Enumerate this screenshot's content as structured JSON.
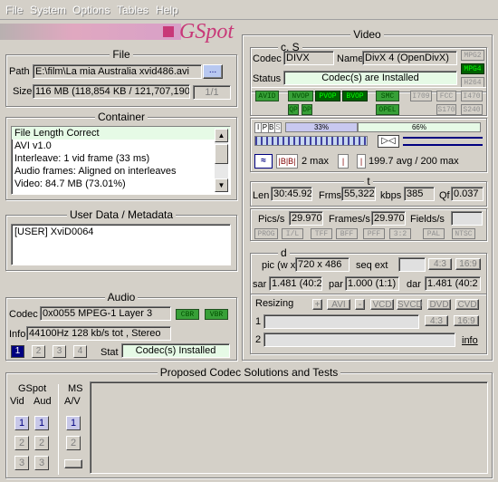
{
  "menu": {
    "file": "File",
    "system": "System",
    "options": "Options",
    "tables": "Tables",
    "help": "Help"
  },
  "logo": "GSpot",
  "file": {
    "title": "File",
    "path_label": "Path",
    "path": "E:\\film\\La mia Australia xvid486.avi",
    "browse": "...",
    "size_label": "Size",
    "size": "116 MB (118,854 KB / 121,707,190",
    "page": "1/1"
  },
  "container": {
    "title": "Container",
    "lines": [
      "File Length Correct",
      "AVI v1.0",
      "Interleave: 1 vid frame (33 ms)",
      "Audio frames: Aligned on interleaves",
      "Video: 84.7 MB (73.01%)"
    ]
  },
  "userdata": {
    "title": "User Data / Metadata",
    "text": "[USER]   XviD0064"
  },
  "audio": {
    "title": "Audio",
    "codec_label": "Codec",
    "codec": "0x0055 MPEG-1 Layer 3",
    "cbr": "CBR",
    "vbr": "VBR",
    "info_label": "Info",
    "info": "44100Hz  128 kb/s tot , Stereo",
    "tabs": [
      "1",
      "2",
      "3",
      "4"
    ],
    "stat_label": "Stat",
    "stat": "Codec(s) Installed"
  },
  "proposed": {
    "title": "Proposed Codec Solutions and Tests",
    "gspot": "GSpot",
    "vid": "Vid",
    "aud": "Aud",
    "ms": "MS",
    "av": "A/V",
    "nums": [
      "1",
      "2",
      "3"
    ]
  },
  "video": {
    "title": "Video",
    "cs": {
      "title": "c, S",
      "codec_label": "Codec",
      "codec": "DIVX",
      "name_label": "Name",
      "name": "DivX 4 (OpenDivX)",
      "status_label": "Status",
      "status": "Codec(s) are Installed",
      "mpg2": "MPG2",
      "mpg4": "MPG4",
      "h264": "H264"
    },
    "flags": {
      "avid": "AVID",
      "nvop": "NVOP",
      "pvop": "PVOP",
      "bvop": "BVOP",
      "smc": "SMC",
      "qp": "QP",
      "dp": "DP",
      "opel": "OPEL",
      "i709": "I709",
      "fcc": "FCC",
      "i470": "I470",
      "s170": "S170",
      "s240": "S240"
    },
    "frames": {
      "ipbs": [
        "I",
        "P",
        "B",
        "S"
      ],
      "pct1": "33%",
      "pct2": "66%",
      "max2": "2 max",
      "avg": "199.7 avg / 200 max"
    },
    "t": {
      "title": "t",
      "len_label": "Len",
      "len": "30:45.92",
      "frms_label": "Frms",
      "frms": "55,322",
      "kbps_label": "kbps",
      "kbps": "385",
      "qf_label": "Qf",
      "qf": "0.037",
      "pics_label": "Pics/s",
      "pics": "29.970",
      "frames_label": "Frames/s",
      "frames": "29.970",
      "fields_label": "Fields/s",
      "fields": "",
      "tags": [
        "PROG",
        "I/L",
        "TFF",
        "BFF",
        "PFF",
        "3:2",
        "PAL",
        "NTSC"
      ]
    },
    "d": {
      "title": "d",
      "pic_label": "pic (w x",
      "pic": "720 x 486",
      "seq_label": "seq ext",
      "ratio_a": "4:3",
      "ratio_b": "16:9",
      "sar_label": "sar",
      "sar": "1.481 (40:2",
      "par_label": "par",
      "par": "1.000 (1:1)",
      "dar_label": "dar",
      "dar": "1.481 (40:2"
    },
    "resizing": {
      "label": "Resizing",
      "plus": "+",
      "avi": "AVI",
      "minus": "-",
      "vcd": "VCD",
      "svcd": "SVCD",
      "dvd": "DVD",
      "cvd": "CVD",
      "r1": "1",
      "r2": "2",
      "a43": "4:3",
      "a169": "16:9",
      "info": "info"
    }
  }
}
